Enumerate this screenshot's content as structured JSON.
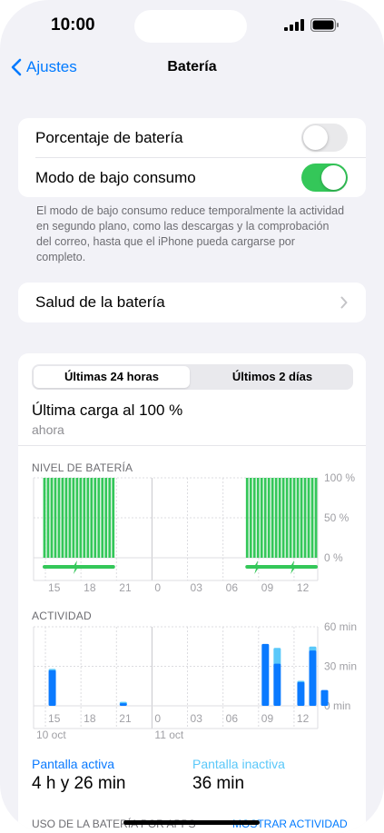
{
  "status_bar": {
    "time": "10:00"
  },
  "nav": {
    "back_label": "Ajustes",
    "title": "Batería"
  },
  "settings": {
    "battery_percentage": {
      "label": "Porcentaje de batería",
      "on": false
    },
    "low_power_mode": {
      "label": "Modo de bajo consumo",
      "on": true
    },
    "footnote": "El modo de bajo consumo reduce temporalmente la actividad en segundo plano, como las descargas y la comprobación del correo, hasta que el iPhone pueda cargarse por completo.",
    "battery_health": {
      "label": "Salud de la batería"
    }
  },
  "colors": {
    "green": "#34c759",
    "blue": "#0a7aff",
    "light_blue": "#5ac8fa",
    "accent": "#007aff"
  },
  "usage": {
    "tabs": [
      "Últimas 24 horas",
      "Últimos 2 días"
    ],
    "selected_tab": 0,
    "last_charge_title": "Última carga al 100 %",
    "last_charge_time": "ahora",
    "screen_on_label": "Pantalla activa",
    "screen_on_value": "4 h y 26 min",
    "screen_off_label": "Pantalla inactiva",
    "screen_off_value": "36 min",
    "by_app_label": "USO DE LA BATERÍA POR APPS",
    "show_activity_label": "MOSTRAR ACTIVIDAD"
  },
  "chart_data": [
    {
      "type": "bar",
      "title": "NIVEL DE BATERÍA",
      "x_tick_labels": [
        "15",
        "18",
        "21",
        "0",
        "03",
        "06",
        "09",
        "12"
      ],
      "y_tick_labels": [
        "100 %",
        "50 %",
        "0 %"
      ],
      "ylim": [
        0,
        100
      ],
      "bars_percent": [
        100,
        100,
        100,
        100,
        100,
        100,
        100,
        100,
        100,
        100,
        100,
        100,
        100,
        100,
        100,
        100,
        100,
        100,
        100,
        100,
        0,
        0,
        0,
        0,
        0,
        0,
        0,
        0,
        0,
        0,
        0,
        0,
        0,
        0,
        0,
        0,
        0,
        0,
        0,
        0,
        0,
        0,
        0,
        0,
        0,
        0,
        0,
        0,
        0,
        0,
        0,
        0,
        0,
        0,
        0,
        0,
        100,
        100,
        100,
        100,
        100,
        100,
        100,
        100,
        100,
        100,
        100,
        100,
        100,
        100,
        100,
        100,
        100,
        100,
        100,
        100
      ],
      "charging_icons_at_bar": [
        9,
        59,
        69
      ]
    },
    {
      "type": "bar",
      "title": "ACTIVIDAD",
      "x_tick_labels": [
        "15",
        "18",
        "21",
        "0",
        "03",
        "06",
        "09",
        "12"
      ],
      "date_labels": [
        "10 oct",
        "11 oct"
      ],
      "y_tick_labels": [
        "60 min",
        "30 min",
        "0 min"
      ],
      "ylim": [
        0,
        60
      ],
      "ylabel": "min",
      "series": [
        {
          "name": "Pantalla activa",
          "values": [
            0,
            27,
            0,
            0,
            0,
            0,
            0,
            0,
            0,
            0,
            0,
            0,
            0,
            0,
            0,
            0,
            0,
            0,
            0,
            0,
            0,
            0,
            0,
            0,
            0,
            0,
            0,
            0,
            0,
            0,
            0,
            0,
            0,
            0,
            0,
            0,
            0,
            0,
            0,
            0,
            0,
            0,
            0,
            0,
            0,
            0,
            0,
            0,
            0,
            0,
            0,
            0,
            0,
            0,
            0,
            0,
            0,
            0,
            0,
            0,
            0,
            0,
            0,
            0,
            0,
            0,
            0,
            0,
            0,
            0,
            0,
            0,
            0,
            0,
            0,
            0,
            0,
            0,
            0,
            0,
            0,
            0,
            0,
            0,
            0,
            0,
            0,
            0,
            0,
            0,
            0,
            0,
            0,
            0,
            0,
            0,
            0,
            0,
            0,
            0,
            0,
            0,
            0,
            0,
            0,
            0,
            0,
            0,
            0,
            0,
            0,
            0,
            0,
            0,
            0,
            0,
            0,
            0,
            0,
            0,
            0
          ]
        },
        {
          "name": "Pantalla inactiva",
          "values": []
        }
      ],
      "hours": [
        "14",
        "15",
        "16",
        "17",
        "18",
        "19",
        "20",
        "21",
        "22",
        "23",
        "0",
        "1",
        "2",
        "3",
        "4",
        "5",
        "6",
        "7",
        "8",
        "9",
        "10",
        "11",
        "12",
        "13"
      ],
      "active_by_hour": [
        0,
        27,
        0,
        0,
        0,
        0,
        0,
        2,
        0,
        0,
        0,
        0,
        0,
        0,
        0,
        0,
        0,
        0,
        0,
        47,
        32,
        0,
        18,
        42,
        12
      ],
      "inactive_by_hour": [
        0,
        1,
        0,
        0,
        0,
        0,
        0,
        1,
        0,
        0,
        0,
        0,
        0,
        0,
        0,
        0,
        0,
        0,
        0,
        0,
        12,
        0,
        1,
        3,
        0
      ]
    }
  ]
}
